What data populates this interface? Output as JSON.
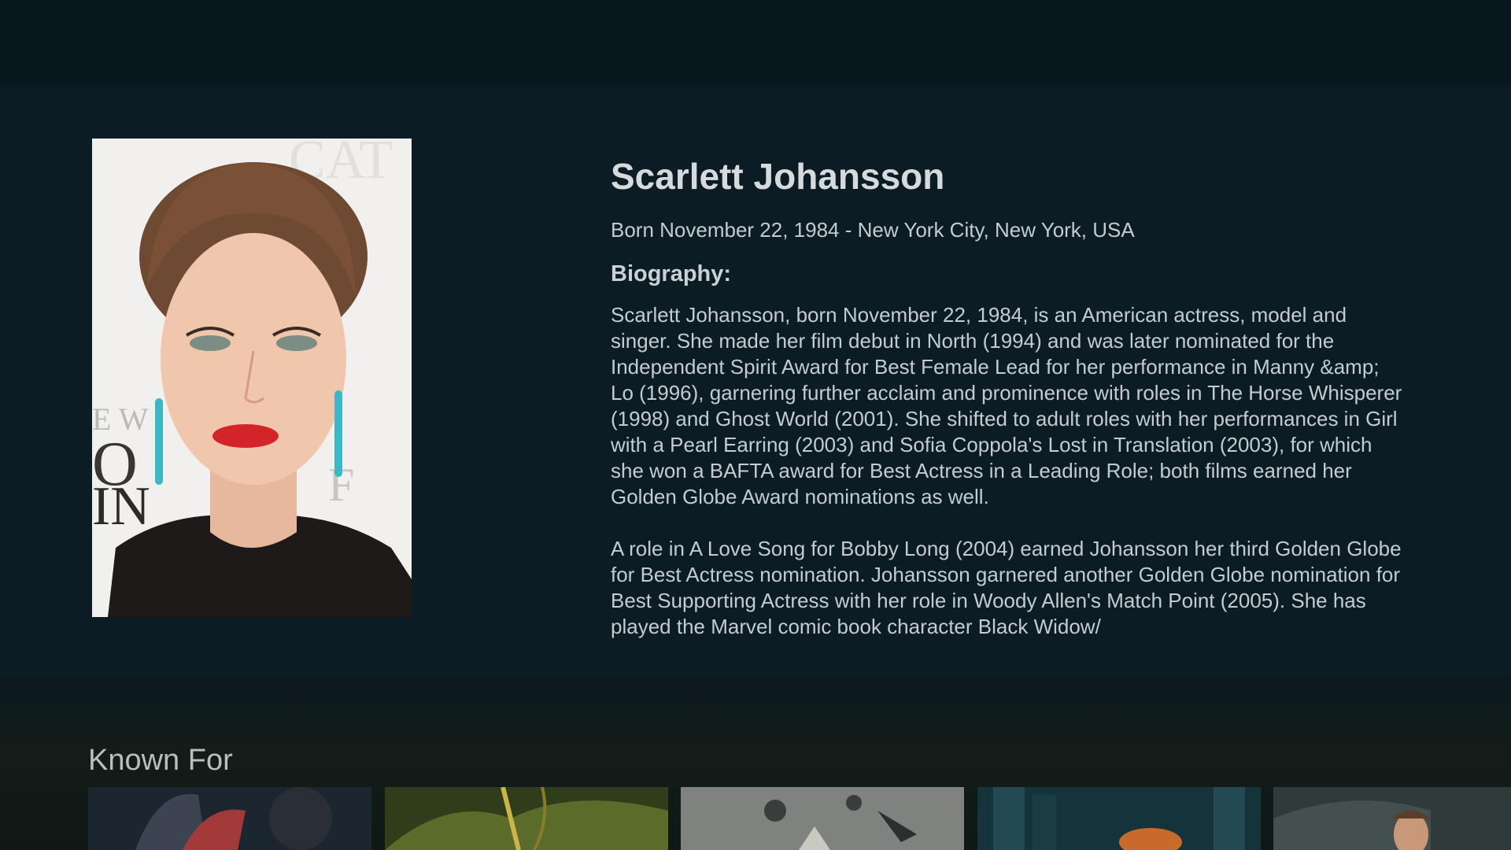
{
  "person": {
    "name": "Scarlett Johansson",
    "born": "Born November 22, 1984 - New York City, New York, USA",
    "biography_heading": "Biography:",
    "biography_paragraphs": [
      "Scarlett Johansson, born November 22, 1984, is an American actress, model and singer. She made her film debut in North (1994) and was later nominated for the Independent Spirit Award for Best Female Lead for her performance in Manny &amp; Lo (1996), garnering further acclaim and prominence with roles in The Horse Whisperer (1998) and Ghost World (2001). She shifted to adult roles with her performances in Girl with a Pearl Earring (2003) and Sofia Coppola's Lost in Translation (2003), for which she won a BAFTA award for Best Actress in a Leading Role; both films earned her Golden Globe Award nominations as well.",
      "A role in A Love Song for Bobby Long (2004) earned Johansson her third Golden Globe for Best Actress nomination. Johansson garnered another Golden Globe nomination for Best Supporting Actress with her role in Woody Allen's Match Point (2005). She has played the Marvel comic book character Black Widow/"
    ],
    "portrait_icon": "portrait-photo"
  },
  "known_for": {
    "title": "Known For",
    "posters": [
      {
        "icon": "poster-shield-hero",
        "color": "#1c2630"
      },
      {
        "icon": "poster-jungle",
        "color": "#3a4a1c"
      },
      {
        "icon": "poster-battle-sky",
        "color": "#8a8c86"
      },
      {
        "icon": "poster-city-fire",
        "color": "#1f3a40"
      },
      {
        "icon": "poster-hero-portrait",
        "color": "#36403f"
      }
    ]
  },
  "colors": {
    "background": "#0b1c24",
    "top_bar": "#08161d",
    "text_primary": "#d6dadd"
  }
}
